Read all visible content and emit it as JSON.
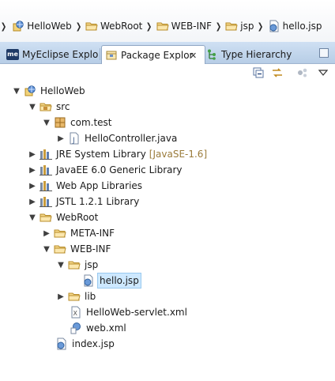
{
  "breadcrumb": {
    "items": [
      {
        "label": "HelloWeb",
        "icon": "web-project-icon"
      },
      {
        "label": "WebRoot",
        "icon": "folder-icon"
      },
      {
        "label": "WEB-INF",
        "icon": "folder-icon"
      },
      {
        "label": "jsp",
        "icon": "folder-icon"
      },
      {
        "label": "hello.jsp",
        "icon": "jsp-file-icon"
      }
    ]
  },
  "tabs": [
    {
      "label": "MyEclipse Explo",
      "icon": "myeclipse-icon",
      "active": false
    },
    {
      "label": "Package Explor",
      "icon": "package-explorer-icon",
      "active": true,
      "close": "✕"
    },
    {
      "label": "Type Hierarchy",
      "icon": "type-hierarchy-icon",
      "active": false
    }
  ],
  "toolbar": {
    "buttons": [
      "collapse-all-icon",
      "link-with-editor-icon",
      "focus-icon",
      "view-menu-icon"
    ]
  },
  "tree": {
    "nodes": [
      {
        "label": "HelloWeb",
        "icon": "web-project-icon",
        "expanded": true,
        "depth": 0
      },
      {
        "label": "src",
        "icon": "source-folder-icon",
        "expanded": true,
        "depth": 1
      },
      {
        "label": "com.test",
        "icon": "package-icon",
        "expanded": true,
        "depth": 2
      },
      {
        "label": "HelloController.java",
        "icon": "java-file-icon",
        "expanded": false,
        "depth": 3
      },
      {
        "label": "JRE System Library",
        "decoration": "[JavaSE-1.6]",
        "icon": "library-icon",
        "expanded": false,
        "depth": 1
      },
      {
        "label": "JavaEE 6.0 Generic Library",
        "icon": "library-icon",
        "expanded": false,
        "depth": 1
      },
      {
        "label": "Web App Libraries",
        "icon": "library-icon",
        "expanded": false,
        "depth": 1
      },
      {
        "label": "JSTL 1.2.1 Library",
        "icon": "library-icon",
        "expanded": false,
        "depth": 1
      },
      {
        "label": "WebRoot",
        "icon": "folder-open-icon",
        "expanded": true,
        "depth": 1
      },
      {
        "label": "META-INF",
        "icon": "folder-icon",
        "expanded": false,
        "depth": 2
      },
      {
        "label": "WEB-INF",
        "icon": "folder-open-icon",
        "expanded": true,
        "depth": 2
      },
      {
        "label": "jsp",
        "icon": "folder-open-icon",
        "expanded": true,
        "depth": 3
      },
      {
        "label": "hello.jsp",
        "icon": "jsp-file-icon",
        "depth": 4,
        "selected": true
      },
      {
        "label": "lib",
        "icon": "folder-icon",
        "expanded": false,
        "depth": 3
      },
      {
        "label": "HelloWeb-servlet.xml",
        "icon": "xml-file-icon",
        "depth": 3
      },
      {
        "label": "web.xml",
        "icon": "web-xml-icon",
        "depth": 3
      },
      {
        "label": "index.jsp",
        "icon": "jsp-file-icon",
        "depth": 2
      }
    ]
  }
}
